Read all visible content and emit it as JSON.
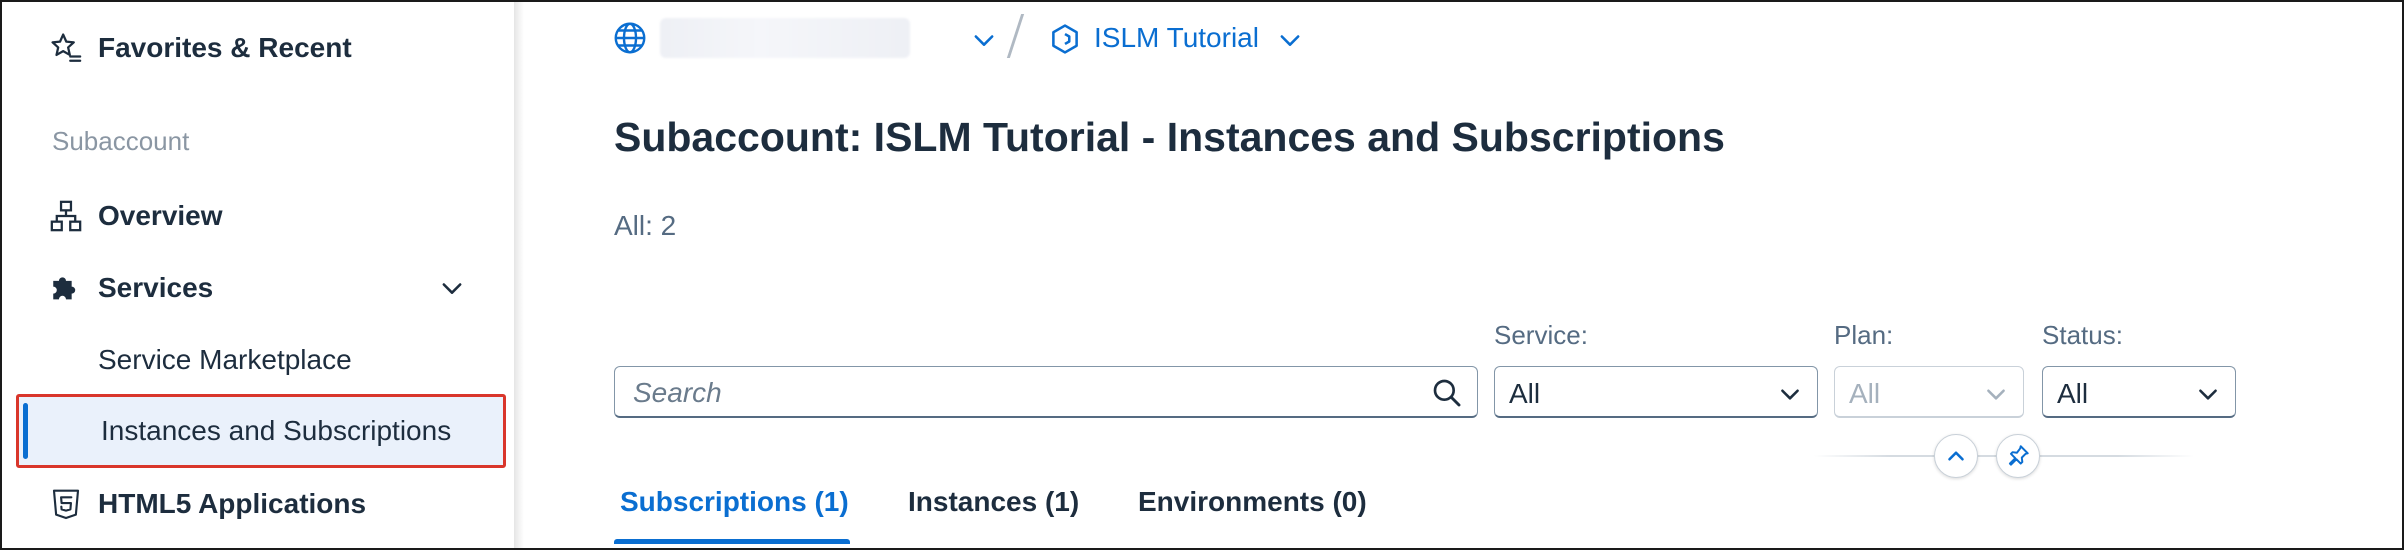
{
  "sidebar": {
    "favorites_label": "Favorites & Recent",
    "section_title": "Subaccount",
    "items": [
      {
        "label": "Overview",
        "icon": "hierarchy-icon"
      },
      {
        "label": "Services",
        "icon": "puzzle-icon",
        "expanded": true
      },
      {
        "label": "Service Marketplace"
      },
      {
        "label": "Instances and Subscriptions",
        "selected": true
      },
      {
        "label": "HTML5 Applications",
        "icon": "html5-icon"
      }
    ]
  },
  "breadcrumb": {
    "globe_icon": "globe-icon",
    "subaccount_label": "ISLM Tutorial",
    "subaccount_icon": "hexagon-icon"
  },
  "page": {
    "title": "Subaccount: ISLM Tutorial - Instances and Subscriptions",
    "count": "All: 2"
  },
  "filters": {
    "search_placeholder": "Search",
    "service_label": "Service:",
    "service_value": "All",
    "plan_label": "Plan:",
    "plan_value": "All",
    "status_label": "Status:",
    "status_value": "All"
  },
  "tabs": [
    {
      "label": "Subscriptions (1)",
      "active": true
    },
    {
      "label": "Instances (1)",
      "active": false
    },
    {
      "label": "Environments (0)",
      "active": false
    }
  ],
  "colors": {
    "accent": "#0a6ed1",
    "text": "#1d2d3e",
    "selection_border": "#d9362b",
    "selection_background": "#eaf1fb"
  }
}
